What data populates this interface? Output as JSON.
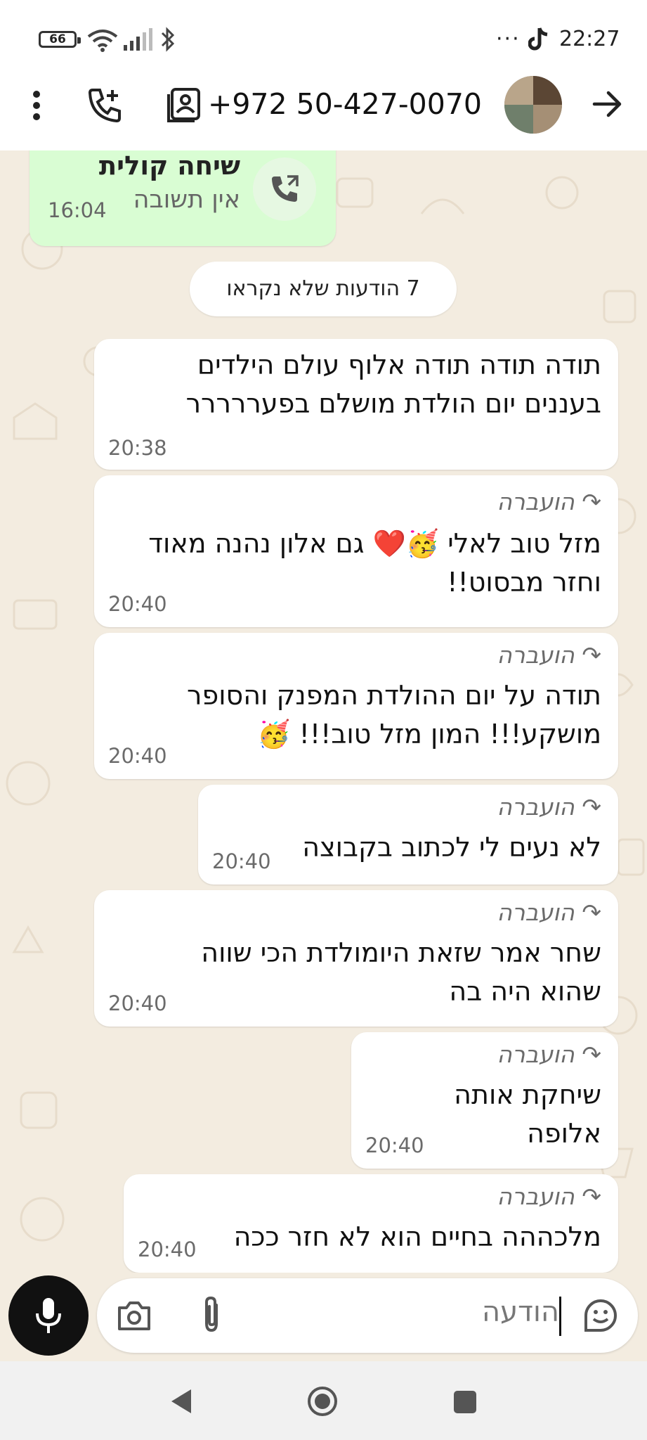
{
  "status_bar": {
    "battery": "66",
    "time": "22:27",
    "more": "···"
  },
  "header": {
    "phone": "+972 50-427-0070"
  },
  "call_bubble": {
    "title": "שיחה קולית",
    "subtitle": "אין תשובה",
    "time": "16:04"
  },
  "unread_badge": "7 הודעות שלא נקראו",
  "messages": [
    {
      "forwarded": "",
      "lines": [
        "תודה תודה תודה אלוף עולם הילדים",
        "בעננים יום הולדת מושלם בפעררררר"
      ],
      "time": "20:38"
    },
    {
      "forwarded": "הועברה",
      "lines": [
        "מזל טוב לאלי 🥳❤️ גם אלון נהנה מאוד",
        "וחזר מבסוט!!"
      ],
      "time": "20:40"
    },
    {
      "forwarded": "הועברה",
      "lines": [
        "תודה על יום ההולדת המפנק והסופר",
        "מושקע!!! המון מזל טוב!!! 🥳"
      ],
      "time": "20:40"
    },
    {
      "forwarded": "הועברה",
      "lines": [
        "לא נעים לי לכתוב בקבוצה"
      ],
      "time": "20:40"
    },
    {
      "forwarded": "הועברה",
      "lines": [
        "שחר אמר שזאת היומולדת הכי שווה",
        "שהוא היה בה"
      ],
      "time": "20:40"
    },
    {
      "forwarded": "הועברה",
      "lines": [
        "שיחקת אותה",
        "אלופה"
      ],
      "time": "20:40"
    },
    {
      "forwarded": "הועברה",
      "lines": [
        "מלכההה בחיים הוא לא חזר ככה"
      ],
      "time": "20:40"
    }
  ],
  "composer": {
    "placeholder": "הודעה"
  },
  "colors": {
    "chat_bg": "#f3ece0",
    "outgoing_bubble": "#d9fdd3",
    "incoming_bubble": "#ffffff",
    "mic_button": "#111111"
  },
  "icons": [
    "overflow-menu-icon",
    "add-call-icon",
    "contact-card-icon",
    "avatar",
    "back-arrow-icon",
    "call-icon",
    "forward-icon",
    "mic-icon",
    "camera-icon",
    "attach-icon",
    "sticker-icon",
    "nav-back-icon",
    "nav-home-icon",
    "nav-recents-icon"
  ]
}
